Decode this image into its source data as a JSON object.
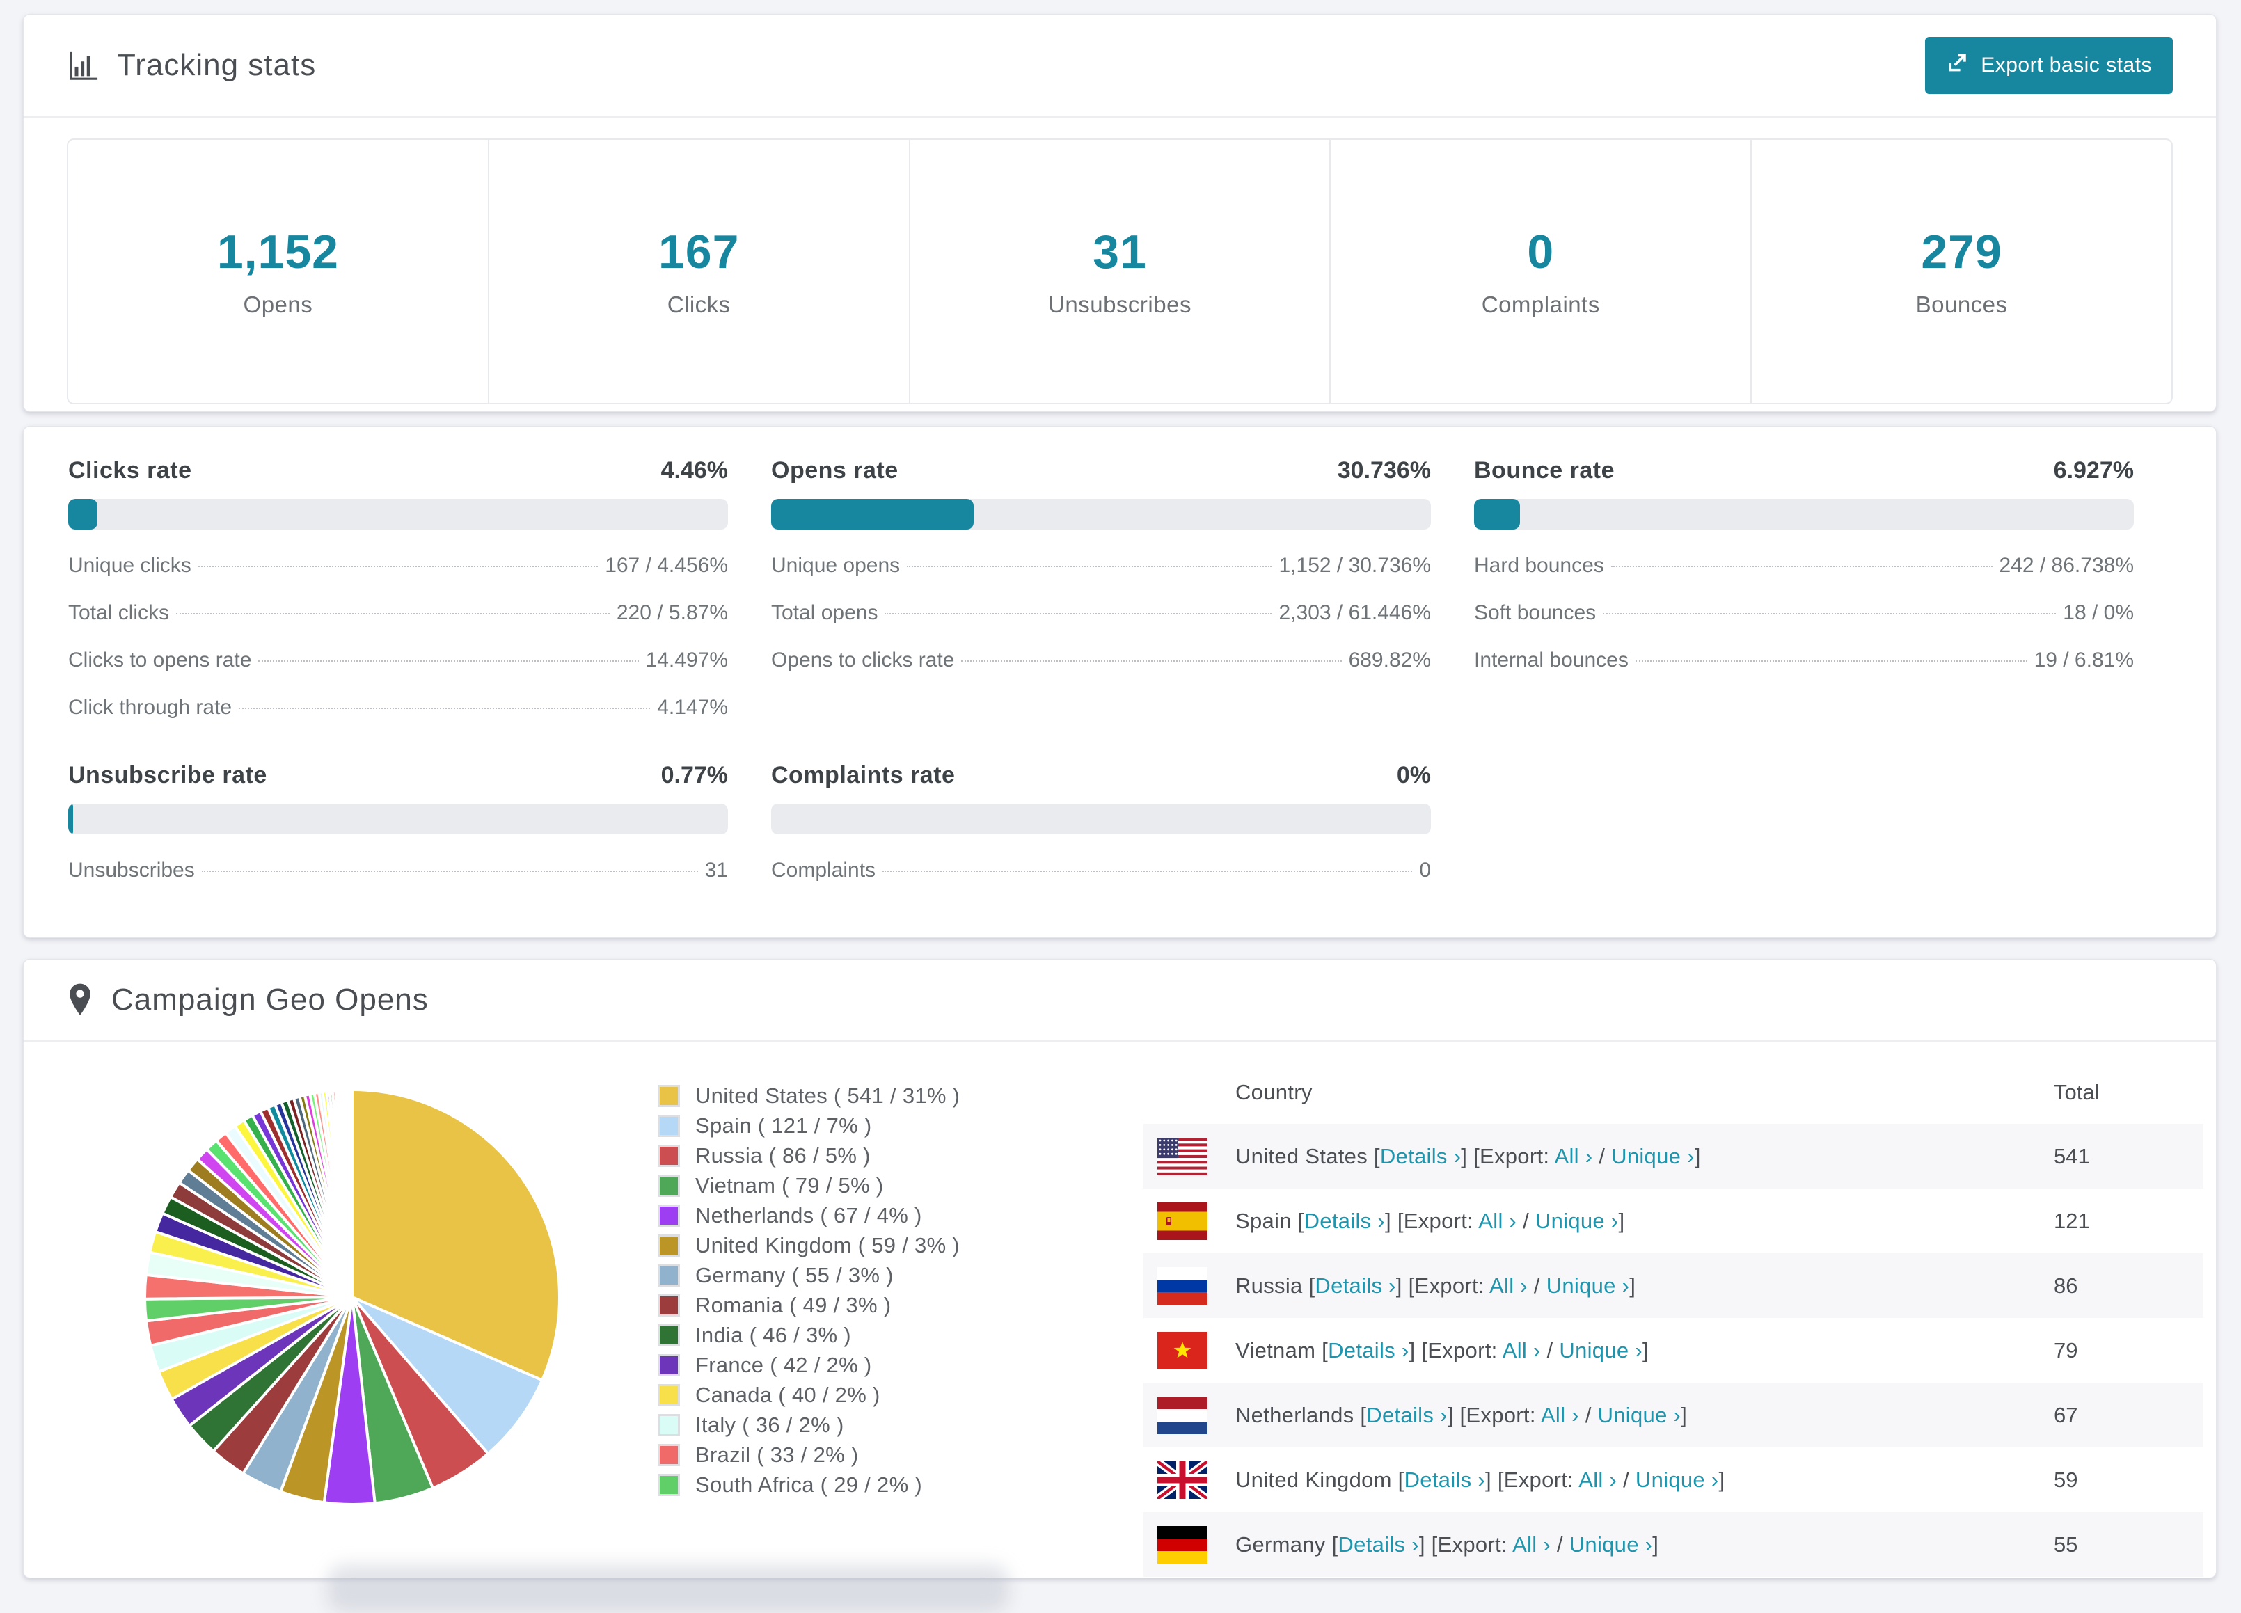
{
  "theme": {
    "accent": "#17869f",
    "heading_color": "#4a4e52",
    "muted_color": "#6f7478"
  },
  "tracking": {
    "title": "Tracking stats",
    "export_button": "Export basic stats",
    "stats": [
      {
        "value": "1,152",
        "label": "Opens"
      },
      {
        "value": "167",
        "label": "Clicks"
      },
      {
        "value": "31",
        "label": "Unsubscribes"
      },
      {
        "value": "0",
        "label": "Complaints"
      },
      {
        "value": "279",
        "label": "Bounces"
      }
    ]
  },
  "rates": {
    "sections": [
      {
        "title": "Clicks rate",
        "value": "4.46%",
        "percent": 4.46,
        "row_group": "top",
        "rows": [
          {
            "label": "Unique clicks",
            "value": "167 / 4.456%"
          },
          {
            "label": "Total clicks",
            "value": "220 / 5.87%"
          },
          {
            "label": "Clicks to opens rate",
            "value": "14.497%"
          },
          {
            "label": "Click through rate",
            "value": "4.147%"
          }
        ]
      },
      {
        "title": "Opens rate",
        "value": "30.736%",
        "percent": 30.736,
        "row_group": "top",
        "rows": [
          {
            "label": "Unique opens",
            "value": "1,152 / 30.736%"
          },
          {
            "label": "Total opens",
            "value": "2,303 / 61.446%"
          },
          {
            "label": "Opens to clicks rate",
            "value": "689.82%"
          }
        ]
      },
      {
        "title": "Bounce rate",
        "value": "6.927%",
        "percent": 6.927,
        "row_group": "top",
        "rows": [
          {
            "label": "Hard bounces",
            "value": "242 / 86.738%"
          },
          {
            "label": "Soft bounces",
            "value": "18 / 0%"
          },
          {
            "label": "Internal bounces",
            "value": "19 / 6.81%"
          }
        ]
      },
      {
        "title": "Unsubscribe rate",
        "value": "0.77%",
        "percent": 0.77,
        "row_group": "bottom",
        "rows": [
          {
            "label": "Unsubscribes",
            "value": "31"
          }
        ]
      },
      {
        "title": "Complaints rate",
        "value": "0%",
        "percent": 0,
        "row_group": "bottom",
        "rows": [
          {
            "label": "Complaints",
            "value": "0"
          }
        ]
      }
    ]
  },
  "geo": {
    "title": "Campaign Geo Opens",
    "table": {
      "columns": [
        "Country",
        "Total"
      ],
      "link_labels": {
        "details": "Details ›",
        "export_prefix": "Export:",
        "all": "All ›",
        "unique": "Unique ›"
      },
      "rows": [
        {
          "country": "United States",
          "flag": "us",
          "total": "541"
        },
        {
          "country": "Spain",
          "flag": "es",
          "total": "121"
        },
        {
          "country": "Russia",
          "flag": "ru",
          "total": "86"
        },
        {
          "country": "Vietnam",
          "flag": "vn",
          "total": "79"
        },
        {
          "country": "Netherlands",
          "flag": "nl",
          "total": "67"
        },
        {
          "country": "United Kingdom",
          "flag": "gb",
          "total": "59"
        },
        {
          "country": "Germany",
          "flag": "de",
          "total": "55"
        }
      ]
    }
  },
  "chart_data": {
    "type": "pie",
    "title": "Campaign Geo Opens",
    "unit": "opens",
    "legend_position": "right",
    "slices": [
      {
        "name": "United States",
        "value": 541,
        "pct": 31,
        "color": "#e8c345"
      },
      {
        "name": "Spain",
        "value": 121,
        "pct": 7,
        "color": "#b5d8f6"
      },
      {
        "name": "Russia",
        "value": 86,
        "pct": 5,
        "color": "#cd4e50"
      },
      {
        "name": "Vietnam",
        "value": 79,
        "pct": 5,
        "color": "#4fa857"
      },
      {
        "name": "Netherlands",
        "value": 67,
        "pct": 4,
        "color": "#9e3ef2"
      },
      {
        "name": "United Kingdom",
        "value": 59,
        "pct": 3,
        "color": "#bb9627"
      },
      {
        "name": "Germany",
        "value": 55,
        "pct": 3,
        "color": "#90b2cc"
      },
      {
        "name": "Romania",
        "value": 49,
        "pct": 3,
        "color": "#9c3c3c"
      },
      {
        "name": "India",
        "value": 46,
        "pct": 3,
        "color": "#2f7434"
      },
      {
        "name": "France",
        "value": 42,
        "pct": 2,
        "color": "#6d35ba"
      },
      {
        "name": "Canada",
        "value": 40,
        "pct": 2,
        "color": "#f8e04b"
      },
      {
        "name": "Italy",
        "value": 36,
        "pct": 2,
        "color": "#d9fcf6"
      },
      {
        "name": "Brazil",
        "value": 33,
        "pct": 2,
        "color": "#f16a6a"
      },
      {
        "name": "South Africa",
        "value": 29,
        "pct": 2,
        "color": "#60cf68"
      }
    ],
    "others": {
      "note": "long tail of small unlabeled countries",
      "values": [
        32,
        30,
        28,
        26,
        24,
        22,
        20,
        19,
        18,
        17,
        16,
        15,
        14,
        13,
        12,
        11,
        10,
        9,
        9,
        8,
        8,
        7,
        7,
        6,
        6,
        5,
        5,
        4,
        4,
        4,
        3,
        3,
        3,
        2,
        2,
        2,
        2,
        1,
        1,
        1,
        1,
        1
      ],
      "colors": [
        "#f4716d",
        "#e8fff8",
        "#f9f04d",
        "#4527a0",
        "#1b5e20",
        "#8e3b3b",
        "#5f7d95",
        "#9d7d1f",
        "#cf46f0",
        "#59e26f",
        "#ff6b6b",
        "#eafcff",
        "#fdf63f",
        "#35b04a",
        "#7637d6",
        "#9e2f2f",
        "#0f8b9d",
        "#27359b",
        "#14602c",
        "#7c2121",
        "#50687c",
        "#857a14",
        "#e03ae0",
        "#6ef573",
        "#ff8f86",
        "#dcf9fc",
        "#fbff2e",
        "#5b1fe0",
        "#2c7f36",
        "#c22222",
        "#4054f4",
        "#00b89b",
        "#b41af0",
        "#52d41c",
        "#fa2f4b",
        "#19dcf5",
        "#f5e52a",
        "#2b3ff2",
        "#12c659",
        "#e01414"
      ]
    }
  }
}
